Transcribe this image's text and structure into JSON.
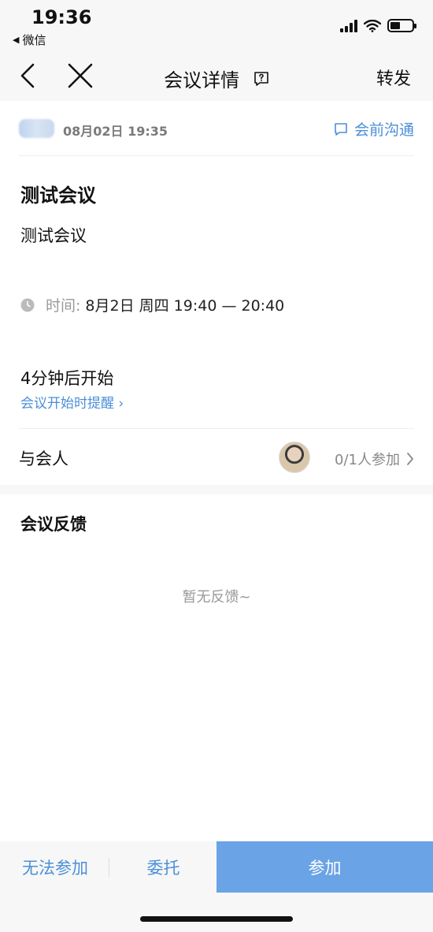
{
  "status_bar": {
    "time": "19:36",
    "back_app": "微信"
  },
  "nav": {
    "title": "会议详情",
    "forward": "转发"
  },
  "meeting": {
    "host_time": "08月02日 19:35",
    "chat_link": "会前沟通",
    "title": "测试会议",
    "description": "测试会议",
    "time_label": "时间:",
    "time_value": "8月2日 周四 19:40 — 20:40",
    "countdown": "4分钟后开始",
    "reminder": "会议开始时提醒 ›"
  },
  "participants": {
    "label": "与会人",
    "count": "0/1人参加"
  },
  "feedback": {
    "title": "会议反馈",
    "empty": "暂无反馈~"
  },
  "actions": {
    "decline": "无法参加",
    "delegate": "委托",
    "join": "参加"
  },
  "colors": {
    "accent": "#4b8fd8",
    "join_button": "#6aa3e6"
  }
}
